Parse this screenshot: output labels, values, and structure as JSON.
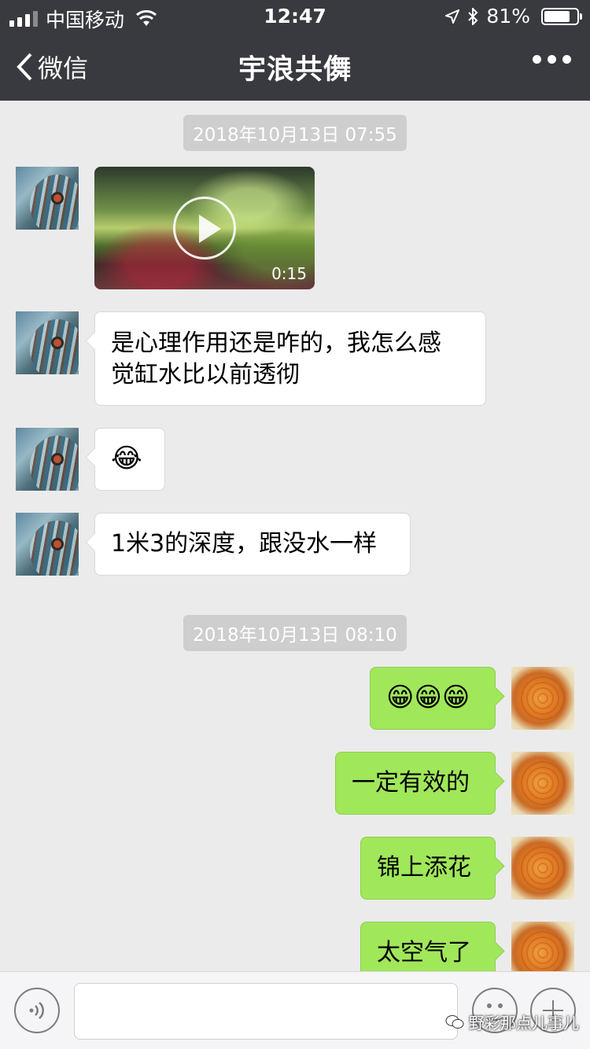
{
  "status_bar": {
    "carrier": "中国移动",
    "time": "12:47",
    "battery_percent": "81%",
    "battery_level": 0.81
  },
  "nav": {
    "back_label": "微信",
    "title": "宇浪共儛",
    "more_icon": "more-dots-icon"
  },
  "chat": {
    "timestamps": [
      "2018年10月13日 07:55",
      "2018年10月13日 08:10"
    ],
    "messages": [
      {
        "side": "left",
        "type": "video",
        "duration": "0:15"
      },
      {
        "side": "left",
        "type": "text",
        "text": "是心理作用还是咋的，我怎么感",
        "text2": "觉缸水比以前透彻"
      },
      {
        "side": "left",
        "type": "emoji",
        "text": "😂"
      },
      {
        "side": "left",
        "type": "text",
        "text": "1米3的深度，跟没水一样"
      },
      {
        "side": "right",
        "type": "emoji",
        "text": "😁😁😁"
      },
      {
        "side": "right",
        "type": "text",
        "text": "一定有效的"
      },
      {
        "side": "right",
        "type": "text",
        "text": "锦上添花"
      },
      {
        "side": "right",
        "type": "text",
        "text": "太空气了"
      }
    ]
  },
  "input_bar": {
    "voice_icon": "voice-icon",
    "emoji_icon": "emoji-face-icon",
    "plus_icon": "plus-icon",
    "watermark": "野彩那点儿事儿"
  }
}
